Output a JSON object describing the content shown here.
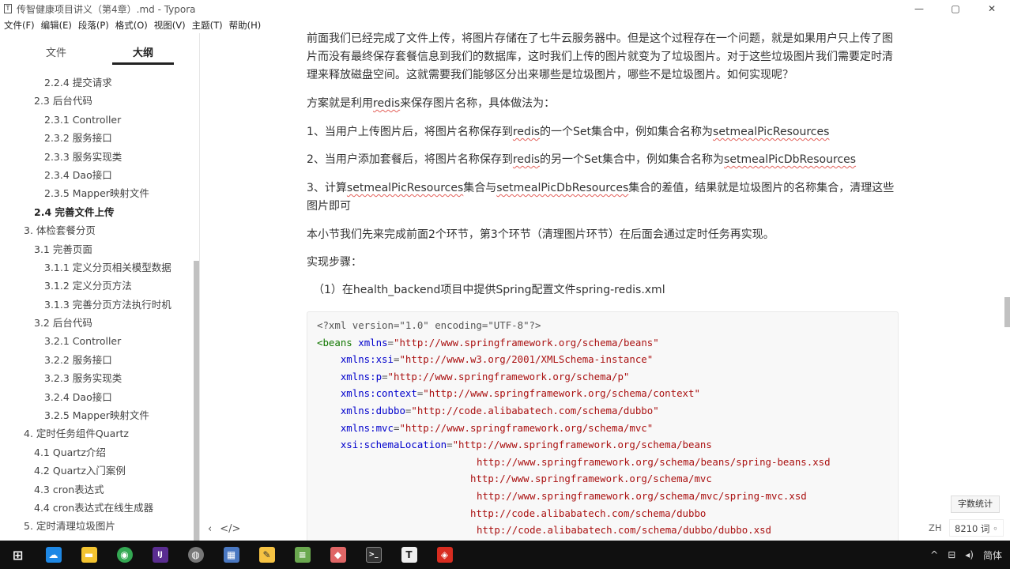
{
  "window": {
    "app_icon": "T",
    "title": "传智健康项目讲义（第4章）.md - Typora",
    "controls": [
      "—",
      "▢",
      "✕"
    ]
  },
  "menu": [
    "文件(F)",
    "编辑(E)",
    "段落(P)",
    "格式(O)",
    "视图(V)",
    "主题(T)",
    "帮助(H)"
  ],
  "sidebar": {
    "tab_files": "文件",
    "tab_outline": "大纲",
    "items": [
      {
        "text": "2.2.4 提交请求",
        "level": 3
      },
      {
        "text": "2.3 后台代码",
        "level": 2
      },
      {
        "text": "2.3.1 Controller",
        "level": 3
      },
      {
        "text": "2.3.2 服务接口",
        "level": 3
      },
      {
        "text": "2.3.3 服务实现类",
        "level": 3
      },
      {
        "text": "2.3.4 Dao接口",
        "level": 3
      },
      {
        "text": "2.3.5 Mapper映射文件",
        "level": 3
      },
      {
        "text": "2.4 完善文件上传",
        "level": 2,
        "active": true
      },
      {
        "text": "3. 体检套餐分页",
        "level": 1
      },
      {
        "text": "3.1 完善页面",
        "level": 2
      },
      {
        "text": "3.1.1 定义分页相关模型数据",
        "level": 3
      },
      {
        "text": "3.1.2 定义分页方法",
        "level": 3
      },
      {
        "text": "3.1.3 完善分页方法执行时机",
        "level": 3
      },
      {
        "text": "3.2 后台代码",
        "level": 2
      },
      {
        "text": "3.2.1 Controller",
        "level": 3
      },
      {
        "text": "3.2.2 服务接口",
        "level": 3
      },
      {
        "text": "3.2.3 服务实现类",
        "level": 3
      },
      {
        "text": "3.2.4 Dao接口",
        "level": 3
      },
      {
        "text": "3.2.5 Mapper映射文件",
        "level": 3
      },
      {
        "text": "4. 定时任务组件Quartz",
        "level": 1
      },
      {
        "text": "4.1 Quartz介绍",
        "level": 2
      },
      {
        "text": "4.2 Quartz入门案例",
        "level": 2
      },
      {
        "text": "4.3 cron表达式",
        "level": 2
      },
      {
        "text": "4.4 cron表达式在线生成器",
        "level": 2
      },
      {
        "text": "5. 定时清理垃圾图片",
        "level": 1
      }
    ],
    "footer_left": "‹",
    "footer_code": "</>"
  },
  "content": {
    "p1": "前面我们已经完成了文件上传，将图片存储在了七牛云服务器中。但是这个过程存在一个问题，就是如果用户只上传了图片而没有最终保存套餐信息到我们的数据库，这时我们上传的图片就变为了垃圾图片。对于这些垃圾图片我们需要定时清理来释放磁盘空间。这就需要我们能够区分出来哪些是垃圾图片，哪些不是垃圾图片。如何实现呢？",
    "p2_a": "方案就是利用",
    "p2_b": "redis",
    "p2_c": "来保存图片名称，具体做法为：",
    "p3_a": "1、当用户上传图片后，将图片名称保存到",
    "p3_b": "redis",
    "p3_c": "的一个Set集合中，例如集合名称为",
    "p3_d": "setmealPicResources",
    "p4_a": "2、当用户添加套餐后，将图片名称保存到",
    "p4_b": "redis",
    "p4_c": "的另一个Set集合中，例如集合名称为",
    "p4_d": "setmealPicDbResources",
    "p5_a": "3、计算",
    "p5_b": "setmealPicResources",
    "p5_c": "集合与",
    "p5_d": "setmealPicDbResources",
    "p5_e": "集合的差值，结果就是垃圾图片的名称集合，清理这些图片即可",
    "p6": "本小节我们先来完成前面2个环节，第3个环节（清理图片环节）在后面会通过定时任务再实现。",
    "p7": "实现步骤：",
    "p8": "（1）在health_backend项目中提供Spring配置文件spring-redis.xml",
    "code": {
      "l1": "<?xml version=\"1.0\" encoding=\"UTF-8\"?>",
      "l2_tag": "<beans",
      "l2_attr": "xmlns",
      "l2_str": "\"http://www.springframework.org/schema/beans\"",
      "l3_attr": "xmlns:xsi",
      "l3_str": "\"http://www.w3.org/2001/XMLSchema-instance\"",
      "l4_attr": "xmlns:p",
      "l4_str": "\"http://www.springframework.org/schema/p\"",
      "l5_attr": "xmlns:context",
      "l5_str": "\"http://www.springframework.org/schema/context\"",
      "l6_attr": "xmlns:dubbo",
      "l6_str": "\"http://code.alibabatech.com/schema/dubbo\"",
      "l7_attr": "xmlns:mvc",
      "l7_str": "\"http://www.springframework.org/schema/mvc\"",
      "l8_attr": "xsi:schemaLocation",
      "l8_str": "\"http://www.springframework.org/schema/beans",
      "l9": "http://www.springframework.org/schema/beans/spring-beans.xsd",
      "l10": "http://www.springframework.org/schema/mvc",
      "l11": "http://www.springframework.org/schema/mvc/spring-mvc.xsd",
      "l12": "http://code.alibabatech.com/schema/dubbo",
      "l13": "http://code.alibabatech.com/schema/dubbo/dubbo.xsd"
    }
  },
  "status": {
    "word_count_button": "字数统计",
    "lang": "ZH",
    "words": "8210 词 ◦"
  },
  "taskbar": {
    "apps": [
      {
        "name": "windows-start-icon",
        "glyph": "⊞",
        "color": "#101010"
      },
      {
        "name": "cloud-app-icon",
        "glyph": "☁",
        "color": "#1e88e5"
      },
      {
        "name": "file-explorer-icon",
        "glyph": "▬",
        "color": "#f4c430"
      },
      {
        "name": "chrome-icon",
        "glyph": "◉",
        "color": "#34a853"
      },
      {
        "name": "intellij-icon",
        "glyph": "IJ",
        "color": "#5a2d91"
      },
      {
        "name": "browser-icon",
        "glyph": "◍",
        "color": "#777777"
      },
      {
        "name": "image-viewer-icon",
        "glyph": "▦",
        "color": "#4a78c2"
      },
      {
        "name": "notes-app-icon",
        "glyph": "✎",
        "color": "#f6c343"
      },
      {
        "name": "notepad-icon",
        "glyph": "≡",
        "color": "#6aa84f"
      },
      {
        "name": "paint-icon",
        "glyph": "◆",
        "color": "#e06666"
      },
      {
        "name": "terminal-icon",
        "glyph": ">_",
        "color": "#333333"
      },
      {
        "name": "typora-icon",
        "glyph": "T",
        "color": "#555555"
      },
      {
        "name": "redis-icon",
        "glyph": "◈",
        "color": "#d82c20"
      }
    ],
    "tray_arrow": "^",
    "tray_network": "⊟",
    "tray_volume": "◂)",
    "tray_ime": "简体"
  }
}
